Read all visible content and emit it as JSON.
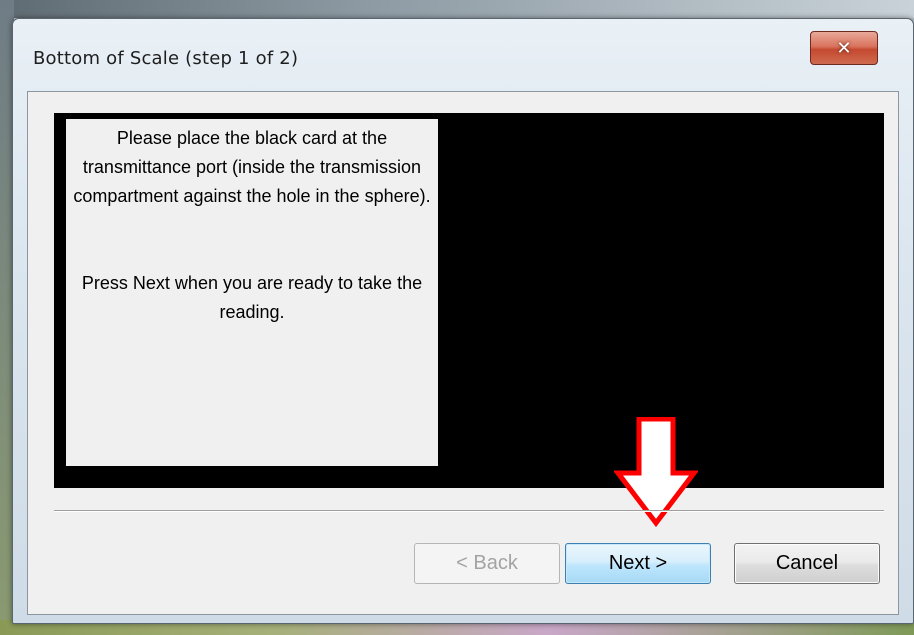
{
  "dialog": {
    "title": "Bottom of Scale (step 1 of 2)",
    "close_glyph": "✕"
  },
  "instructions": {
    "line1": "Please place the black card at the transmittance port (inside the transmission compartment against the hole in the sphere).",
    "line2": "Press Next when you are ready to take the reading."
  },
  "buttons": {
    "back_label": "< Back",
    "next_label": "Next >",
    "cancel_label": "Cancel",
    "back_enabled": false
  },
  "annotation": {
    "arrow_icon": "red-down-arrow-icon",
    "arrow_color": "#ff0000"
  },
  "colors": {
    "image_panel": "#000000",
    "client_bg": "#f0f0f0",
    "close_button": "#c44a30"
  }
}
